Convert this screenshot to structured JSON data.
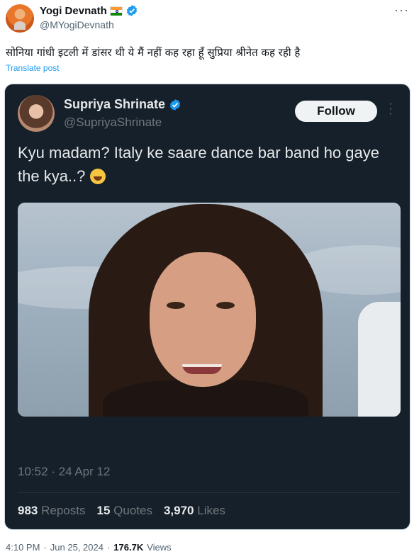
{
  "post": {
    "author_name": "Yogi Devnath",
    "author_handle": "@MYogiDevnath",
    "text": "सोनिया गांधी इटली में डांसर थी ये मैं नहीं कह रहा हूँ सुप्रिया श्रीनेत कह रही है",
    "translate_label": "Translate post",
    "time": "4:10 PM",
    "separator": "·",
    "date": "Jun 25, 2024",
    "views_count": "176.7K",
    "views_label": "Views",
    "more_icon": "more-horizontal-icon"
  },
  "embedded": {
    "author_name": "Supriya Shrinate",
    "author_handle": "@SupriyaShrinate",
    "follow_label": "Follow",
    "text": "Kyu madam? Italy ke saare dance bar band ho gaye the kya..?",
    "emoji": "laughing-with-tears-emoji",
    "timestamp": "10:52 · 24 Apr 12",
    "stats": [
      {
        "num": "983",
        "label": "Reposts"
      },
      {
        "num": "15",
        "label": "Quotes"
      },
      {
        "num": "3,970",
        "label": "Likes"
      }
    ]
  },
  "colors": {
    "link": "#1d9bf0",
    "verified": "#1d9bf0",
    "card_bg": "#15202b"
  }
}
